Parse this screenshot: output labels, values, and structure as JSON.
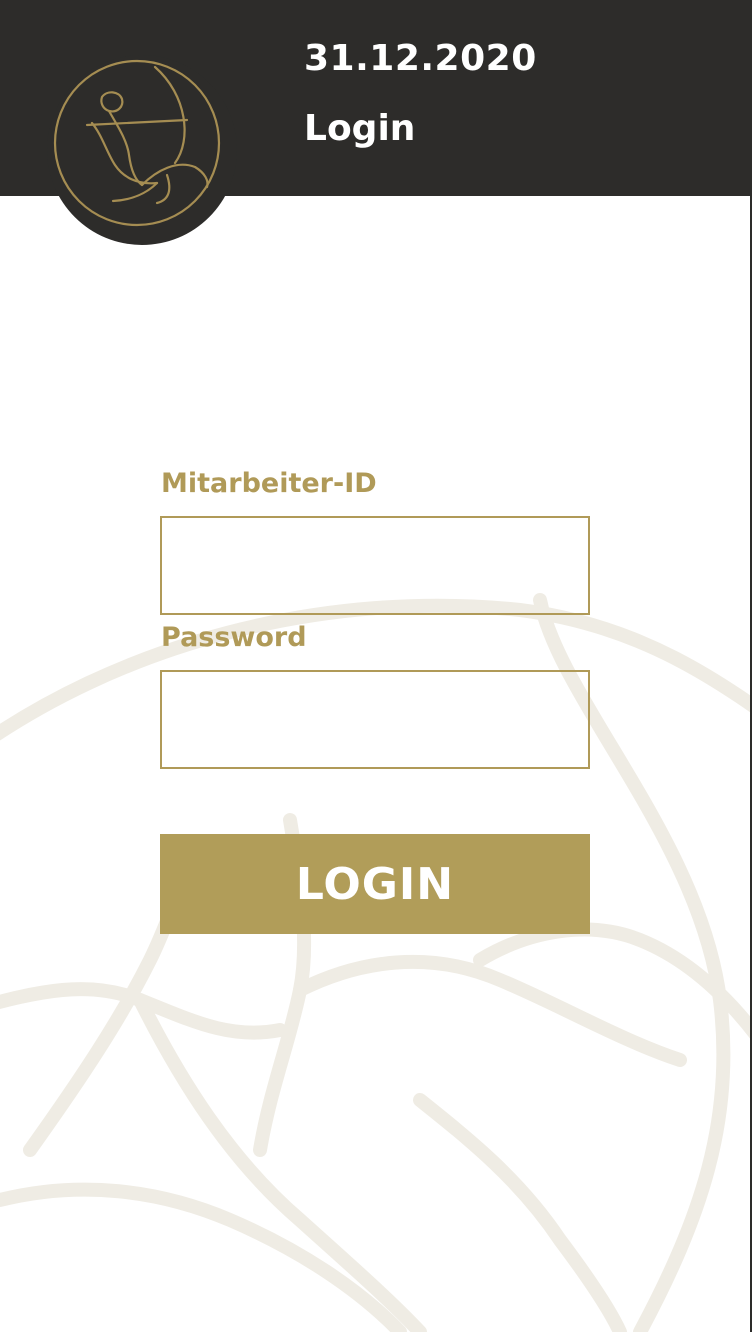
{
  "header": {
    "date": "31.12.2020",
    "title": "Login",
    "logo_icon": "archer-icon",
    "background_color": "#2d2c2a"
  },
  "form": {
    "employee_id_label": "Mitarbeiter-ID",
    "employee_id_value": "",
    "password_label": "Password",
    "password_value": "",
    "login_button_label": "LOGIN"
  },
  "colors": {
    "accent": "#b09a58",
    "button": "#b19d59",
    "watermark": "#efece4"
  }
}
